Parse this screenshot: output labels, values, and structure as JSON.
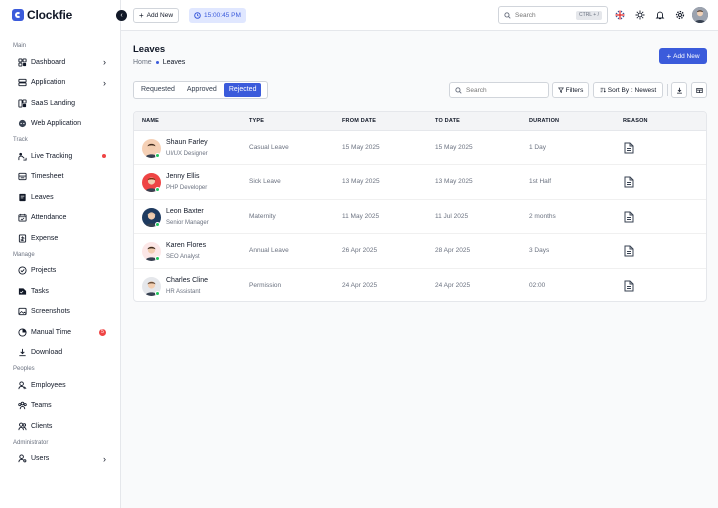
{
  "app": {
    "name": "Clockfie"
  },
  "sidebar": {
    "sections": [
      {
        "label": "Main",
        "items": [
          {
            "label": "Dashboard",
            "icon": "dashboard-icon",
            "chevron": true
          },
          {
            "label": "Application",
            "icon": "application-icon",
            "chevron": true
          },
          {
            "label": "SaaS Landing",
            "icon": "saas-icon"
          },
          {
            "label": "Web Application",
            "icon": "web-application-icon"
          }
        ]
      },
      {
        "label": "Track",
        "items": [
          {
            "label": "Live Tracking",
            "icon": "live-tracking-icon",
            "dot": true
          },
          {
            "label": "Timesheet",
            "icon": "timesheet-icon"
          },
          {
            "label": "Leaves",
            "icon": "leaves-icon"
          },
          {
            "label": "Attendance",
            "icon": "attendance-icon"
          },
          {
            "label": "Expense",
            "icon": "expense-icon"
          }
        ]
      },
      {
        "label": "Manage",
        "items": [
          {
            "label": "Projects",
            "icon": "projects-icon"
          },
          {
            "label": "Tasks",
            "icon": "tasks-icon"
          },
          {
            "label": "Screenshots",
            "icon": "screenshots-icon"
          },
          {
            "label": "Manual Time",
            "icon": "manual-time-icon",
            "badge": "5"
          },
          {
            "label": "Download",
            "icon": "download-icon"
          }
        ]
      },
      {
        "label": "Peoples",
        "items": [
          {
            "label": "Employees",
            "icon": "employees-icon"
          },
          {
            "label": "Teams",
            "icon": "teams-icon"
          },
          {
            "label": "Clients",
            "icon": "clients-icon"
          }
        ]
      },
      {
        "label": "Administrator",
        "items": [
          {
            "label": "Users",
            "icon": "users-icon",
            "chevron": true
          }
        ]
      }
    ]
  },
  "topbar": {
    "add_new": "Add New",
    "clock": "15:00:45 PM",
    "search_placeholder": "Search",
    "shortcut": "CTRL + /"
  },
  "page": {
    "title": "Leaves",
    "breadcrumb_home": "Home",
    "breadcrumb_current": "Leaves",
    "add_new": "Add New"
  },
  "tabs": [
    {
      "label": "Requested",
      "active": false
    },
    {
      "label": "Approved",
      "active": false
    },
    {
      "label": "Rejected",
      "active": true
    }
  ],
  "toolbar": {
    "search_placeholder": "Search",
    "filters": "Filters",
    "sort": "Sort By : Newest"
  },
  "table": {
    "columns": [
      "NAME",
      "TYPE",
      "FROM DATE",
      "TO DATE",
      "DURATION",
      "REASON"
    ],
    "rows": [
      {
        "name": "Shaun Farley",
        "role": "UI/UX Designer",
        "type": "Casual Leave",
        "from": "15 May 2025",
        "to": "15 May 2025",
        "duration": "1 Day",
        "avatar_bg": "#f5d0b5",
        "avatar_fg": "#3f2a1d"
      },
      {
        "name": "Jenny Ellis",
        "role": "PHP Developer",
        "type": "Sick Leave",
        "from": "13 May 2025",
        "to": "13 May 2025",
        "duration": "1st Half",
        "avatar_bg": "#ef4444",
        "avatar_fg": "#7c2d12"
      },
      {
        "name": "Leon Baxter",
        "role": "Senior Manager",
        "type": "Maternity",
        "from": "11 May 2025",
        "to": "11 Jul 2025",
        "duration": "2 months",
        "avatar_bg": "#1e3a5f",
        "avatar_fg": "#e5c3a6"
      },
      {
        "name": "Karen Flores",
        "role": "SEO Analyst",
        "type": "Annual Leave",
        "from": "26 Apr 2025",
        "to": "28 Apr 2025",
        "duration": "3 Days",
        "avatar_bg": "#fce7e7",
        "avatar_fg": "#3f2a1d"
      },
      {
        "name": "Charles Cline",
        "role": "HR Assistant",
        "type": "Permission",
        "from": "24 Apr 2025",
        "to": "24 Apr 2025",
        "duration": "02:00",
        "avatar_bg": "#e5e7eb",
        "avatar_fg": "#6b4f3a"
      }
    ]
  },
  "colors": {
    "accent": "#3b5bdb",
    "online": "#22c55e",
    "alert": "#ef4444"
  }
}
